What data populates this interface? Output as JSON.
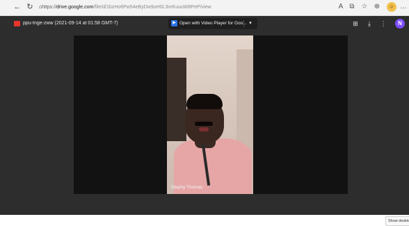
{
  "browser": {
    "url_prefix": "https://",
    "url_host": "drive.google.com",
    "url_path": "/file/d/1bzHo6Pw54eByDw9uH0L3nrKuuuW8PeP/view",
    "icons": [
      "back-arrow-icon",
      "refresh-icon",
      "lock-icon",
      "read-aloud-icon",
      "extensions-icon",
      "favorites-icon",
      "collections-icon",
      "profile-icon",
      "more-icon"
    ]
  },
  "viewer": {
    "file_title": "ppu-tnge-zww (2021-09-14 at 01:58 GMT-7)",
    "open_with": {
      "label": "Open with Video Player for Goo...",
      "caret": "▾"
    },
    "header_icons": [
      "add-to-drive-icon",
      "download-icon",
      "more-vert-icon"
    ],
    "avatar_initial": "N",
    "video": {
      "participant_name": "Stephy Thomas"
    },
    "tooltip": "Show desktop"
  },
  "colors": {
    "viewer_bg": "#2d2d2d",
    "video_bg": "#121212",
    "avatar": "#7c4dff",
    "file_icon": "#e8352b",
    "open_with_icon": "#2a73e8"
  }
}
